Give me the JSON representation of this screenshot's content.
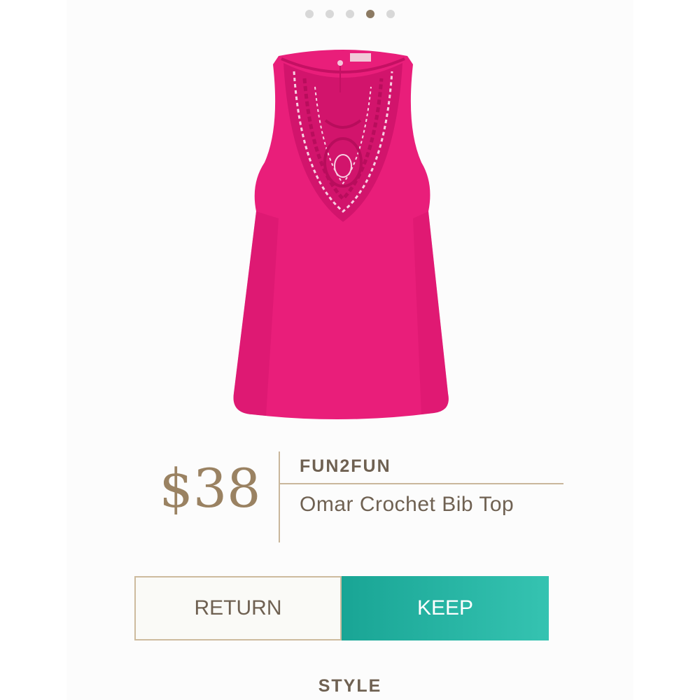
{
  "carousel": {
    "total": 5,
    "active_index": 3
  },
  "product": {
    "image_icon": "sleeveless-top-image",
    "color": "#e91e7a",
    "price": "$38",
    "brand": "FUN2FUN",
    "name": "Omar Crochet Bib Top"
  },
  "actions": {
    "return_label": "RETURN",
    "keep_label": "KEEP"
  },
  "section": {
    "label": "STYLE"
  },
  "colors": {
    "accent": "#9a8262",
    "keep": "#25b3a1",
    "text": "#6f6152"
  }
}
